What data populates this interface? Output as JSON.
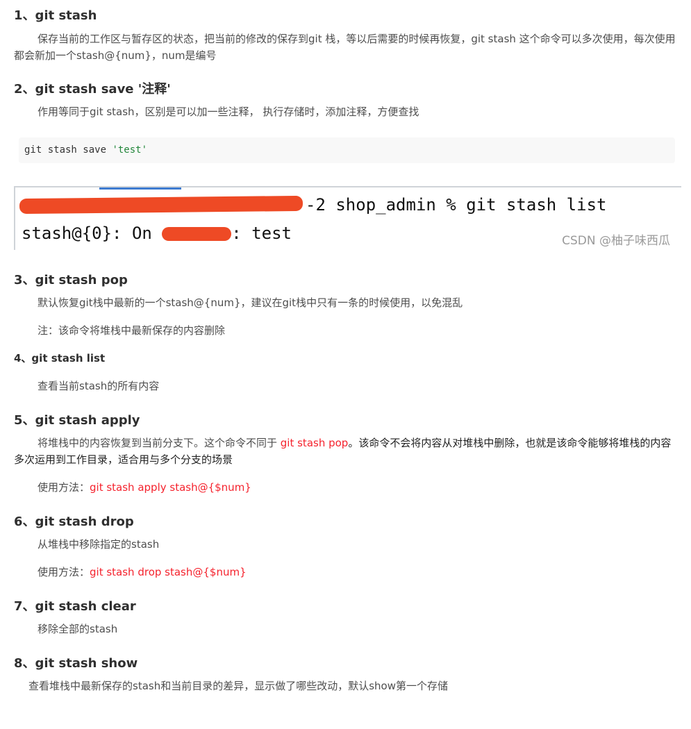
{
  "sections": [
    {
      "heading": "1、git stash",
      "para": "保存当前的工作区与暂存区的状态，把当前的修改的保存到git 栈，等以后需要的时候再恢复，git stash 这个命令可以多次使用，每次使用都会新加一个stash@{num}，num是编号"
    },
    {
      "heading": "2、git stash save '注释'",
      "para": "作用等同于git stash，区别是可以加一些注释， 执行存储时，添加注释，方便查找"
    },
    {
      "heading": "3、git stash pop",
      "para": "默认恢复git栈中最新的一个stash@{num}，建议在git栈中只有一条的时候使用，以免混乱",
      "note": "注：该命令将堆栈中最新保存的内容删除"
    },
    {
      "heading": "4、git stash list",
      "para": "查看当前stash的所有内容"
    },
    {
      "heading": "5、git stash apply",
      "para_a": "将堆栈中的内容恢复到当前分支下。这个命令不同于 ",
      "para_red": "git stash pop",
      "para_b": "。该命令不会将内容从对堆栈中删除，也就是该命令能够将堆栈的内容多次运用到工作目录，适合用与多个分支的场景",
      "usage_label": "使用方法：",
      "usage_cmd": "git stash apply stash@{$num}"
    },
    {
      "heading": "6、git stash drop",
      "para": "从堆栈中移除指定的stash",
      "usage_label": "使用方法：",
      "usage_cmd": "git stash drop stash@{$num}"
    },
    {
      "heading": "7、git stash clear",
      "para": "移除全部的stash"
    },
    {
      "heading": "8、git stash show",
      "para": "查看堆栈中最新保存的stash和当前目录的差异，显示做了哪些改动，默认show第一个存储"
    }
  ],
  "code_block": {
    "cmd": "git stash save ",
    "arg": "'test'"
  },
  "terminal": {
    "line1_visible": "-2 shop_admin % git stash list",
    "line2_a": "stash@{0}: On ",
    "line2_b": ": test"
  },
  "watermark": "CSDN @柚子味西瓜",
  "colors": {
    "accent_red": "#f5222d",
    "scribble": "#ee4a25",
    "tab_blue": "#3e7bd1"
  }
}
